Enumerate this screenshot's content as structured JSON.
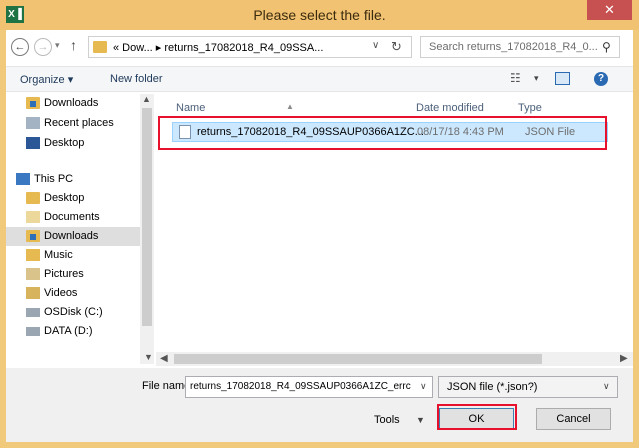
{
  "window": {
    "title": "Please select the file.",
    "app_icon_text": "X┃",
    "close_glyph": "✕"
  },
  "address_bar": {
    "breadcrumb": "« Dow... ▸ returns_17082018_R4_09SSA...",
    "search_placeholder": "Search returns_17082018_R4_0..."
  },
  "toolbar": {
    "organize_label": "Organize ▾",
    "new_folder_label": "New folder"
  },
  "nav_pane": {
    "items": [
      {
        "label": "Downloads",
        "icon": "downloads-folder-icon"
      },
      {
        "label": "Recent places",
        "icon": "recent-places-icon"
      },
      {
        "label": "Desktop",
        "icon": "desktop-icon"
      },
      {
        "label": "This PC",
        "icon": "this-pc-icon"
      },
      {
        "label": "Desktop",
        "icon": "desktop-folder-icon"
      },
      {
        "label": "Documents",
        "icon": "documents-folder-icon"
      },
      {
        "label": "Downloads",
        "icon": "downloads-folder-icon",
        "selected": true
      },
      {
        "label": "Music",
        "icon": "music-folder-icon"
      },
      {
        "label": "Pictures",
        "icon": "pictures-folder-icon"
      },
      {
        "label": "Videos",
        "icon": "videos-folder-icon"
      },
      {
        "label": "OSDisk (C:)",
        "icon": "drive-icon"
      },
      {
        "label": "DATA (D:)",
        "icon": "drive-icon"
      }
    ]
  },
  "file_list": {
    "columns": [
      "Name",
      "Date modified",
      "Type"
    ],
    "rows": [
      {
        "name": "returns_17082018_R4_09SSAUP0366A1ZC...",
        "date_modified": "08/17/18 4:43 PM",
        "type": "JSON File",
        "selected": true
      }
    ]
  },
  "bottom": {
    "file_name_label": "File name:",
    "file_name_value": "returns_17082018_R4_09SSAUP0366A1ZC_errc",
    "file_type_value": "JSON file (*.json?)",
    "tools_label": "Tools",
    "ok_label": "OK",
    "cancel_label": "Cancel"
  },
  "colors": {
    "titlebar": "#f1c271",
    "close_button": "#c75050",
    "selection": "#cce8ff",
    "highlight_annotation": "#e8112d"
  }
}
